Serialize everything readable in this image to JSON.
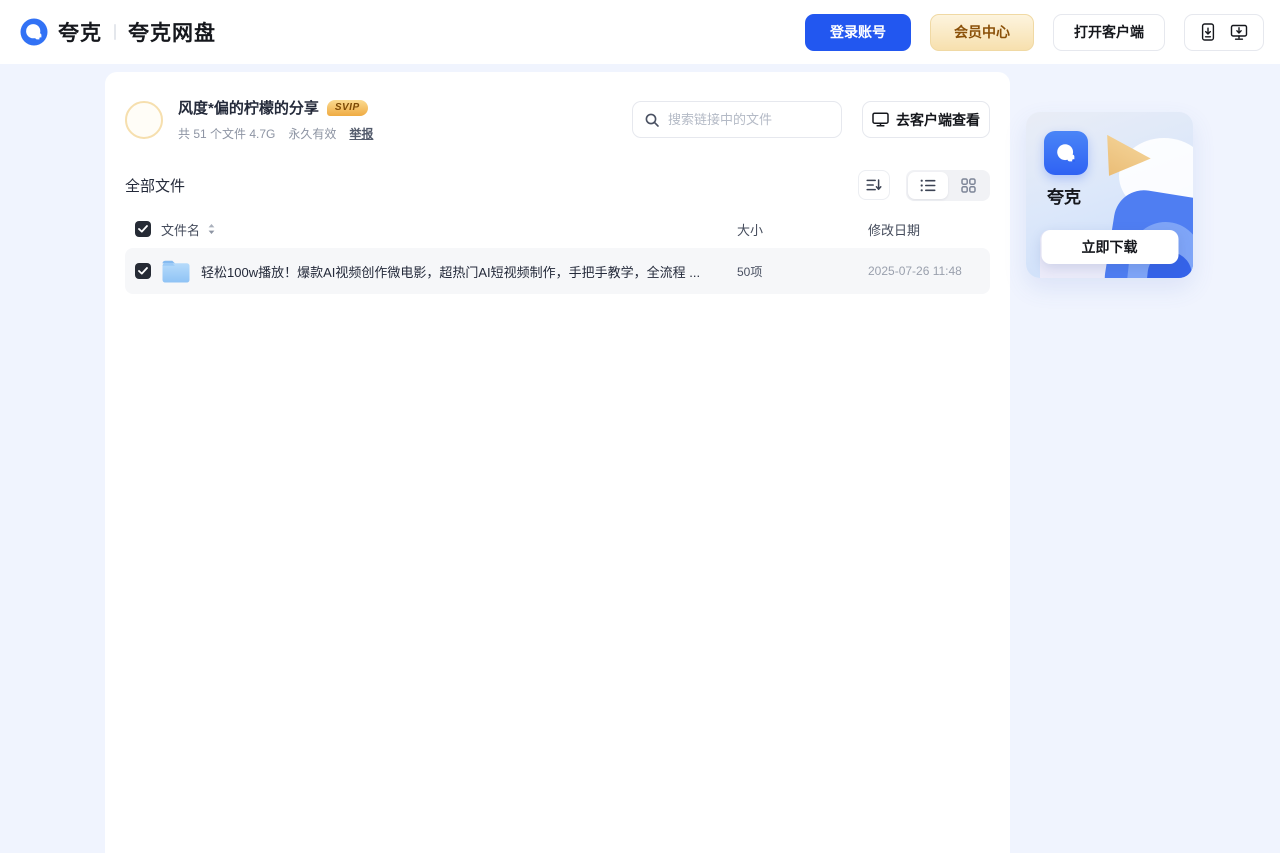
{
  "header": {
    "brand": "夸克",
    "product": "夸克网盘",
    "login_button": "登录账号",
    "member_button": "会员中心",
    "open_client_button": "打开客户端"
  },
  "share": {
    "owner_title": "风度*偏的柠檬的分享",
    "svip_badge": "SVIP",
    "file_count": "共 51 个文件 4.7G",
    "validity": "永久有效",
    "report_link": "举报",
    "search_placeholder": "搜索链接中的文件",
    "client_view_button": "去客户端查看"
  },
  "file_list": {
    "section_title": "全部文件",
    "columns": {
      "name": "文件名",
      "size": "大小",
      "date": "修改日期"
    },
    "rows": [
      {
        "name": "轻松100w播放！爆款AI视频创作微电影，超热门AI短视频制作，手把手教学，全流程 ...",
        "size": "50项",
        "date": "2025-07-26 11:48"
      }
    ]
  },
  "promo_card": {
    "app_name": "夸克",
    "download_button": "立即下载"
  },
  "colors": {
    "accent_blue": "#2257f0",
    "logo_blue": "#3272f5",
    "page_background": "#f0f4fe",
    "member_gold_text": "#8a5008",
    "row_background": "#f6f7f9"
  }
}
